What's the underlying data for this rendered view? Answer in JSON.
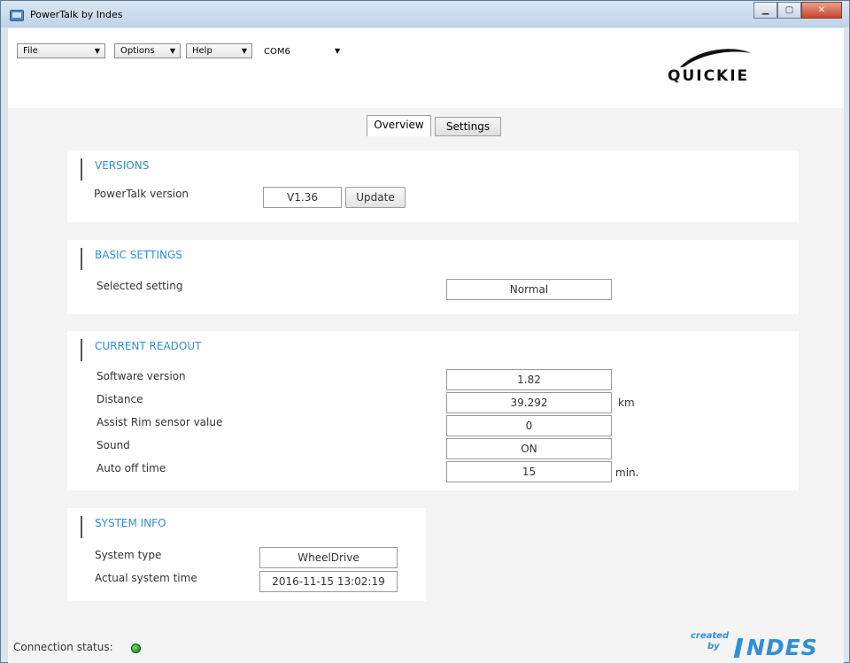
{
  "window": {
    "title": "PowerTalk by Indes"
  },
  "menubar": {
    "file": "File",
    "options": "Options",
    "help": "Help",
    "port": "COM6"
  },
  "logo": {
    "text": "QUICKIE"
  },
  "tabs": [
    {
      "label": "Overview",
      "active": true
    },
    {
      "label": "Settings",
      "active": false
    }
  ],
  "versions": {
    "heading": "VERSIONS",
    "label": "PowerTalk version",
    "value": "V1.36",
    "button": "Update"
  },
  "basic_settings": {
    "heading": "BASIC SETTINGS",
    "label": "Selected setting",
    "value": "Normal"
  },
  "current_readout": {
    "heading": "CURRENT READOUT",
    "rows": [
      {
        "label": "Software version",
        "value": "1.82",
        "unit": ""
      },
      {
        "label": "Distance",
        "value": "39.292",
        "unit": "km"
      },
      {
        "label": "Assist Rim sensor value",
        "value": "0",
        "unit": ""
      },
      {
        "label": "Sound",
        "value": "ON",
        "unit": ""
      },
      {
        "label": "Auto off time",
        "value": "15",
        "unit": "min."
      }
    ]
  },
  "system_info": {
    "heading": "SYSTEM INFO",
    "rows": [
      {
        "label": "System type",
        "value": "WheelDrive"
      },
      {
        "label": "Actual system time",
        "value": "2016-11-15 13:02:19"
      }
    ]
  },
  "status": {
    "label": "Connection status:",
    "led_color": "#1fa02a"
  },
  "brand": {
    "created": "created",
    "by": "by",
    "name": "NDES"
  },
  "colors": {
    "accent": "#2f8fd6"
  }
}
